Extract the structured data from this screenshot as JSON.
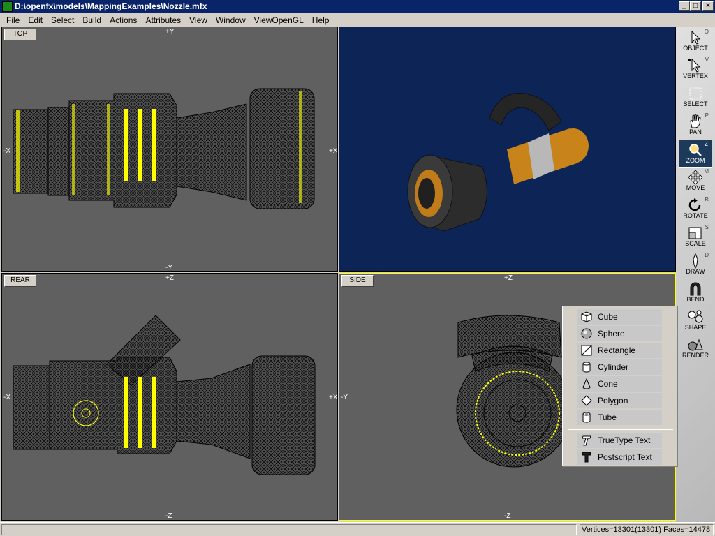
{
  "window": {
    "title": "D:\\openfx\\models\\MappingExamples\\Nozzle.mfx",
    "minimize": "_",
    "maximize": "□",
    "close": "×"
  },
  "menu": [
    "File",
    "Edit",
    "Select",
    "Build",
    "Actions",
    "Attributes",
    "View",
    "Window",
    "ViewOpenGL",
    "Help"
  ],
  "viewports": {
    "top": {
      "label": "TOP",
      "axis_top": "+Y",
      "axis_bottom": "-Y",
      "axis_left": "-X",
      "axis_right": "+X"
    },
    "rear": {
      "label": "REAR",
      "axis_top": "+Z",
      "axis_bottom": "-Z",
      "axis_left": "-X",
      "axis_right": "+X"
    },
    "side": {
      "label": "SIDE",
      "axis_top": "+Z",
      "axis_bottom": "-Z",
      "axis_left": "-Y"
    }
  },
  "tools": [
    {
      "label": "OBJECT",
      "key": "O",
      "icon": "pointer-icon"
    },
    {
      "label": "VERTEX",
      "key": "V",
      "icon": "vertex-pointer-icon"
    },
    {
      "label": "SELECT",
      "key": "",
      "icon": "select-box-icon"
    },
    {
      "label": "PAN",
      "key": "P",
      "icon": "hand-icon"
    },
    {
      "label": "ZOOM",
      "key": "Z",
      "icon": "magnifier-icon"
    },
    {
      "label": "MOVE",
      "key": "M",
      "icon": "move-arrows-icon"
    },
    {
      "label": "ROTATE",
      "key": "R",
      "icon": "rotate-icon"
    },
    {
      "label": "SCALE",
      "key": "S",
      "icon": "scale-icon"
    },
    {
      "label": "DRAW",
      "key": "D",
      "icon": "pen-icon"
    },
    {
      "label": "BEND",
      "key": "",
      "icon": "magnet-icon"
    },
    {
      "label": "SHAPE",
      "key": "",
      "icon": "shapes-icon"
    },
    {
      "label": "RENDER",
      "key": "",
      "icon": "render-icon"
    }
  ],
  "active_tool": "ZOOM",
  "shape_menu": {
    "items": [
      "Cube",
      "Sphere",
      "Rectangle",
      "Cylinder",
      "Cone",
      "Polygon",
      "Tube"
    ],
    "text_items": [
      "TrueType Text",
      "Postscript Text"
    ]
  },
  "status": {
    "counts": "Vertices=13301(13301) Faces=14478"
  },
  "colors": {
    "viewport_bg": "#606060",
    "render_bg": "#0c2456",
    "wire": "#000000",
    "selected": "#ffff00",
    "title_bar": "#0a246a"
  }
}
